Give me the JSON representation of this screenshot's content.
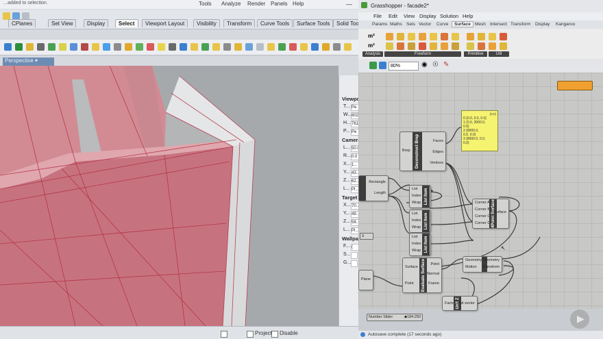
{
  "rhino": {
    "menu": [
      "Tools",
      "Analyze",
      "Render",
      "Panels",
      "Help"
    ],
    "status_top": "…added to selection.",
    "tabs": [
      "CPlanes",
      "Set View",
      "Display",
      "Select",
      "Viewport Layout",
      "Visibility",
      "Transform",
      "Curve Tools",
      "Surface Tools",
      "Solid Tools"
    ],
    "selected_tab": "Select",
    "viewport_label": "Perspective",
    "props": {
      "viewport_header": "Viewport",
      "viewport_rows": [
        {
          "k": "T...",
          "v": "Pe"
        },
        {
          "k": "W...",
          "v": "802"
        },
        {
          "k": "H...",
          "v": "761"
        },
        {
          "k": "P...",
          "v": "Pe"
        }
      ],
      "camera_header": "Camera",
      "camera_rows": [
        {
          "k": "L...",
          "v": "50.0"
        },
        {
          "k": "R...",
          "v": "0.0"
        },
        {
          "k": "X...",
          "v": "1..."
        },
        {
          "k": "Y...",
          "v": "43..."
        },
        {
          "k": "Z...",
          "v": "62..."
        },
        {
          "k": "L...",
          "v": "Pl..."
        }
      ],
      "target_header": "Target",
      "target_rows": [
        {
          "k": "X...",
          "v": "70..."
        },
        {
          "k": "Y...",
          "v": "49..."
        },
        {
          "k": "Z...",
          "v": "58..."
        },
        {
          "k": "L...",
          "v": "Pl..."
        }
      ],
      "wallpaper_header": "Wallpaper",
      "wallpaper_rows": [
        {
          "k": "F...",
          "v": "("
        },
        {
          "k": "S...",
          "v": ""
        },
        {
          "k": "G...",
          "v": ""
        }
      ]
    },
    "bottom": [
      "Project",
      "Disable"
    ]
  },
  "grasshopper": {
    "title": "Grasshopper - facade2*",
    "menu": [
      "File",
      "Edit",
      "View",
      "Display",
      "Solution",
      "Help"
    ],
    "tabs": [
      "Params",
      "Maths",
      "Sets",
      "Vector",
      "Curve",
      "Surface",
      "Mesh",
      "Intersect",
      "Transform",
      "Display",
      "Kangaroo"
    ],
    "selected_tab": "Surface",
    "ribbon_groups": [
      "Analysis",
      "Freeform",
      "Primitive",
      "Util"
    ],
    "zoom": "80%",
    "status": "Autosave complete (17 seconds ago)",
    "panel": {
      "header": "{0;0}",
      "lines": [
        "0 {0.0, 0.0, 0.0}",
        "1 {0.0, 3000.0,",
        "  0.0}",
        "2 {8000.0,",
        "  0.0, 0.0}",
        "3 {8000.0, 0.0,",
        "  0.0}"
      ]
    },
    "components": {
      "deconstruct_brep": {
        "title": "Deconstruct Brep",
        "inputs": [
          "Brep"
        ],
        "outputs": [
          "Faces",
          "Edges",
          "Vertices"
        ]
      },
      "rectangle": {
        "title": "Rectangle",
        "outputs": [
          "Rectangle",
          "Length"
        ]
      },
      "list_item_1": {
        "title": "List Item",
        "inputs": [
          "List",
          "Index",
          "Wrap"
        ]
      },
      "list_item_2": {
        "title": "List Item",
        "inputs": [
          "List",
          "Index",
          "Wrap"
        ]
      },
      "list_item_3": {
        "title": "List Item",
        "inputs": [
          "List",
          "Index",
          "Wrap"
        ]
      },
      "four_point_surface": {
        "title": "4Point Surface",
        "inputs": [
          "Corner A",
          "Corner B",
          "Corner C",
          "Corner D"
        ],
        "outputs": [
          "Surface"
        ]
      },
      "evaluate_surface": {
        "title": "Evaluate Surface",
        "inputs": [
          "Surface",
          "Point"
        ],
        "outputs": [
          "Point",
          "Normal",
          "Frame"
        ]
      },
      "geometry": {
        "title": "Geometry",
        "inputs": [
          "Geometry",
          "Motion"
        ],
        "outputs": [
          "Geometry",
          "Transform"
        ]
      },
      "unit_z": {
        "title": "Unit Z",
        "inputs": [
          "Factor"
        ],
        "outputs": [
          "Unit vector"
        ]
      },
      "plane": {
        "outputs": [
          "Plane"
        ]
      }
    },
    "slider": {
      "label": "Number Slider",
      "value": "◆184.250"
    }
  }
}
